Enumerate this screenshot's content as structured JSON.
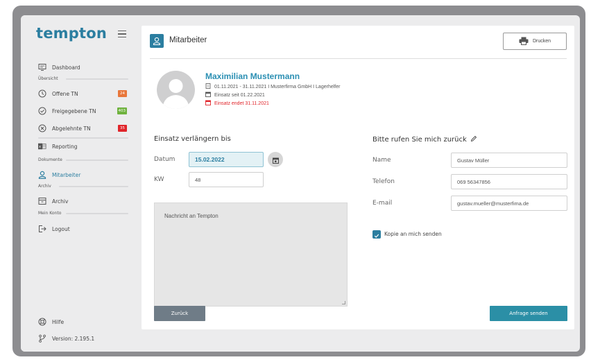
{
  "app": {
    "logo": "tempton",
    "version": "Version: 2.195.1"
  },
  "sidebar": {
    "sections": {
      "overview": "Übersicht",
      "documents": "Dokumente",
      "archive": "Archiv",
      "account": "Mein Konto"
    },
    "items": [
      {
        "label": "Dashboard",
        "icon": "dashboard-icon"
      },
      {
        "label": "Offene TN",
        "icon": "clock-icon",
        "badge": "24",
        "badge_color": "#e8763a"
      },
      {
        "label": "Freigegebene TN",
        "icon": "check-circle-icon",
        "badge": "403",
        "badge_color": "#6fb23e"
      },
      {
        "label": "Abgelehnte TN",
        "icon": "x-circle-icon",
        "badge": "35",
        "badge_color": "#e0242a"
      },
      {
        "label": "Reporting",
        "icon": "excel-icon"
      },
      {
        "label": "Mitarbeiter",
        "icon": "user-icon",
        "active": true
      },
      {
        "label": "Archiv",
        "icon": "archive-icon"
      },
      {
        "label": "Logout",
        "icon": "logout-icon"
      }
    ],
    "help": "Hilfe"
  },
  "header": {
    "title": "Mitarbeiter",
    "print_label": "Drucken"
  },
  "employee": {
    "name": "Maximilian Mustermann",
    "period": "01.11.2021 - 31.11.2021 I Musterfirma GmbH I Lagerhelfer",
    "since": "Einsatz seit 01.22.2021",
    "ends": "Einsatz endet 31.11.2021"
  },
  "extend": {
    "title": "Einsatz verlängern bis",
    "date_label": "Datum",
    "date_value": "15.02.2022",
    "week_label": "KW",
    "week_value": "48",
    "message_placeholder": "Nachricht an Tempton"
  },
  "callback": {
    "title": "Bitte rufen Sie mich zurück",
    "name_label": "Name",
    "name_value": "Gustav Müller",
    "phone_label": "Telefon",
    "phone_value": "069 56347856",
    "email_label": "E-mail",
    "email_value": "gustav.mueller@musterfima.de",
    "copy_label": "Kopie an mich senden"
  },
  "actions": {
    "back": "Zurück",
    "send": "Anfrage senden"
  },
  "colors": {
    "brand": "#2b7ea0",
    "accent_teal": "#2b8fb3",
    "back_button": "#6f7c87",
    "send_button": "#2b8fa6",
    "warning_red": "#e0242a"
  }
}
